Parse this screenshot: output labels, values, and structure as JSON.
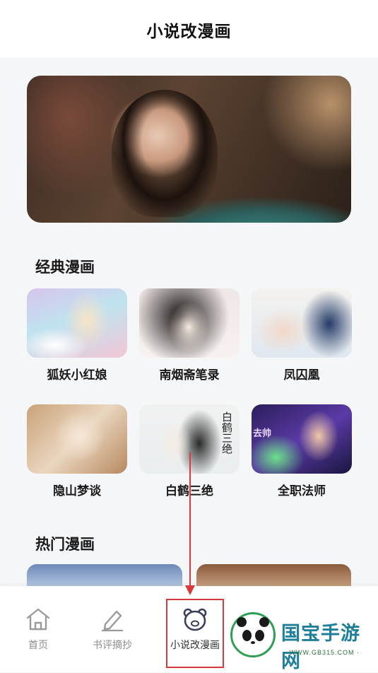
{
  "header": {
    "title": "小说改漫画"
  },
  "banner": {
    "image": "banner-illustration"
  },
  "sections": {
    "classic": {
      "title": "经典漫画",
      "items": [
        {
          "name": "狐妖小红娘"
        },
        {
          "name": "南烟斋笔录"
        },
        {
          "name": "凤囚凰"
        },
        {
          "name": "隐山梦谈"
        },
        {
          "name": "白鹤三绝",
          "cover_text": "白鹤三绝"
        },
        {
          "name": "全职法师",
          "cover_text": "去帅"
        }
      ]
    },
    "hot": {
      "title": "热门漫画"
    }
  },
  "tabbar": {
    "items": [
      {
        "label": "首页",
        "icon": "home-icon"
      },
      {
        "label": "书评摘抄",
        "icon": "pen-icon"
      },
      {
        "label": "小说改漫画",
        "icon": "bear-icon",
        "active": true
      }
    ]
  },
  "watermark": {
    "brand": "国宝手游网",
    "url": "· WWW.GB315.COM ·"
  },
  "colors": {
    "highlight": "#d83a3a",
    "text": "#1a1a1a",
    "inactive_tab": "#8c8c8c",
    "watermark_brand": "#1e7f9b"
  }
}
